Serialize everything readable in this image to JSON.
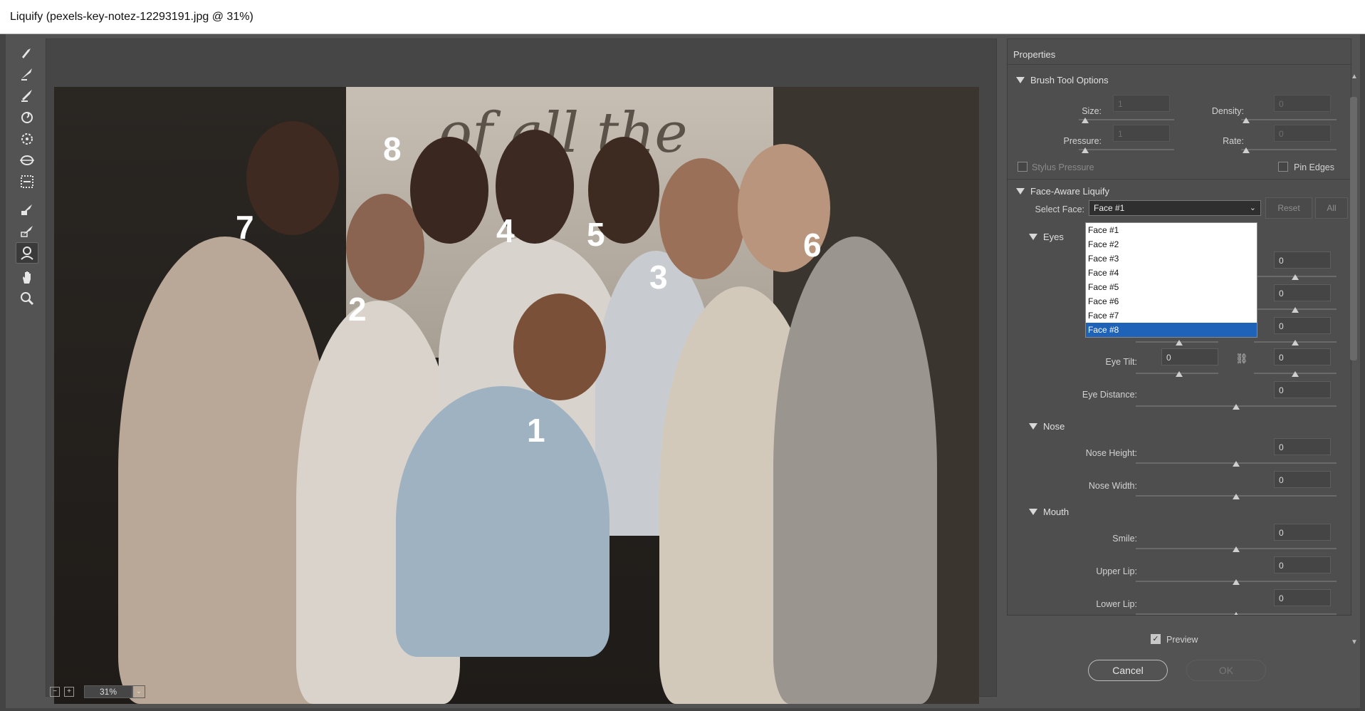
{
  "window": {
    "title": "Liquify (pexels-key-notez-12293191.jpg @ 31%)"
  },
  "tools": [
    {
      "name": "forward-warp-tool-icon"
    },
    {
      "name": "reconstruct-tool-icon"
    },
    {
      "name": "smooth-tool-icon"
    },
    {
      "name": "twirl-tool-icon"
    },
    {
      "name": "pucker-tool-icon"
    },
    {
      "name": "bloat-tool-icon"
    },
    {
      "name": "push-left-tool-icon"
    },
    {
      "name": "freeze-mask-tool-icon"
    },
    {
      "name": "thaw-mask-tool-icon"
    },
    {
      "name": "face-tool-icon"
    },
    {
      "name": "hand-tool-icon"
    },
    {
      "name": "zoom-tool-icon"
    }
  ],
  "canvas": {
    "banner_text": "of all the",
    "face_labels": [
      "7",
      "8",
      "2",
      "4",
      "5",
      "3",
      "6",
      "1"
    ]
  },
  "status": {
    "zoom": "31%",
    "zoom_out": "−",
    "zoom_in": "+"
  },
  "properties": {
    "title": "Properties",
    "brush": {
      "title": "Brush Tool Options",
      "size_label": "Size:",
      "size_value": "1",
      "density_label": "Density:",
      "density_value": "0",
      "pressure_label": "Pressure:",
      "pressure_value": "1",
      "rate_label": "Rate:",
      "rate_value": "0",
      "stylus_label": "Stylus Pressure",
      "pin_label": "Pin Edges"
    },
    "face": {
      "title": "Face-Aware Liquify",
      "select_label": "Select Face:",
      "selected": "Face #1",
      "reset": "Reset",
      "all": "All",
      "options": [
        "Face #1",
        "Face #2",
        "Face #3",
        "Face #4",
        "Face #5",
        "Face #6",
        "Face #7",
        "Face #8"
      ],
      "highlighted": "Face #8"
    },
    "eyes": {
      "title": "Eyes",
      "right_values": [
        "0",
        "0",
        "0"
      ],
      "eye_tilt_label": "Eye Tilt:",
      "eye_tilt_left": "0",
      "eye_tilt_right": "0",
      "eye_distance_label": "Eye Distance:",
      "eye_distance_value": "0"
    },
    "nose": {
      "title": "Nose",
      "height_label": "Nose Height:",
      "height_value": "0",
      "width_label": "Nose Width:",
      "width_value": "0"
    },
    "mouth": {
      "title": "Mouth",
      "smile_label": "Smile:",
      "smile_value": "0",
      "upper_label": "Upper Lip:",
      "upper_value": "0",
      "lower_label": "Lower Lip:",
      "lower_value": "0"
    }
  },
  "footer": {
    "preview_label": "Preview",
    "cancel_label": "Cancel",
    "ok_label": "OK"
  }
}
